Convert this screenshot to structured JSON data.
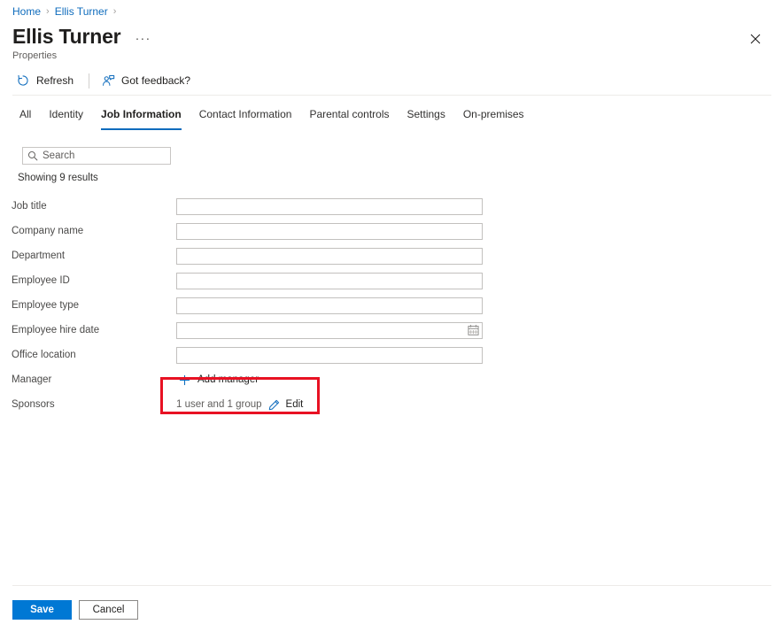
{
  "breadcrumb": {
    "items": [
      {
        "label": "Home"
      },
      {
        "label": "Ellis Turner"
      }
    ],
    "separator": "›"
  },
  "header": {
    "title": "Ellis Turner",
    "ellipsis": "···",
    "subtitle": "Properties",
    "close_label": "Close"
  },
  "commandbar": {
    "refresh_label": "Refresh",
    "feedback_label": "Got feedback?"
  },
  "tabs": [
    {
      "label": "All",
      "active": false
    },
    {
      "label": "Identity",
      "active": false
    },
    {
      "label": "Job Information",
      "active": true
    },
    {
      "label": "Contact Information",
      "active": false
    },
    {
      "label": "Parental controls",
      "active": false
    },
    {
      "label": "Settings",
      "active": false
    },
    {
      "label": "On-premises",
      "active": false
    }
  ],
  "search": {
    "placeholder": "Search",
    "value": ""
  },
  "results_text": "Showing 9 results",
  "fields": {
    "job_title": {
      "label": "Job title",
      "value": ""
    },
    "company_name": {
      "label": "Company name",
      "value": ""
    },
    "department": {
      "label": "Department",
      "value": ""
    },
    "employee_id": {
      "label": "Employee ID",
      "value": ""
    },
    "employee_type": {
      "label": "Employee type",
      "value": ""
    },
    "employee_hire_date": {
      "label": "Employee hire date",
      "value": ""
    },
    "office_location": {
      "label": "Office location",
      "value": ""
    },
    "manager": {
      "label": "Manager",
      "add_label": "Add manager"
    },
    "sponsors": {
      "label": "Sponsors",
      "count_text": "1 user and 1 group",
      "edit_label": "Edit"
    }
  },
  "footer": {
    "save_label": "Save",
    "cancel_label": "Cancel"
  },
  "colors": {
    "accent": "#0f6cbd",
    "primary_button": "#0078d4",
    "highlight": "#e81123",
    "link": "#0f6cbd",
    "text": "#201f1e",
    "muted_text": "#605e5c",
    "border": "#c8c6c4",
    "divider": "#edebe9"
  }
}
